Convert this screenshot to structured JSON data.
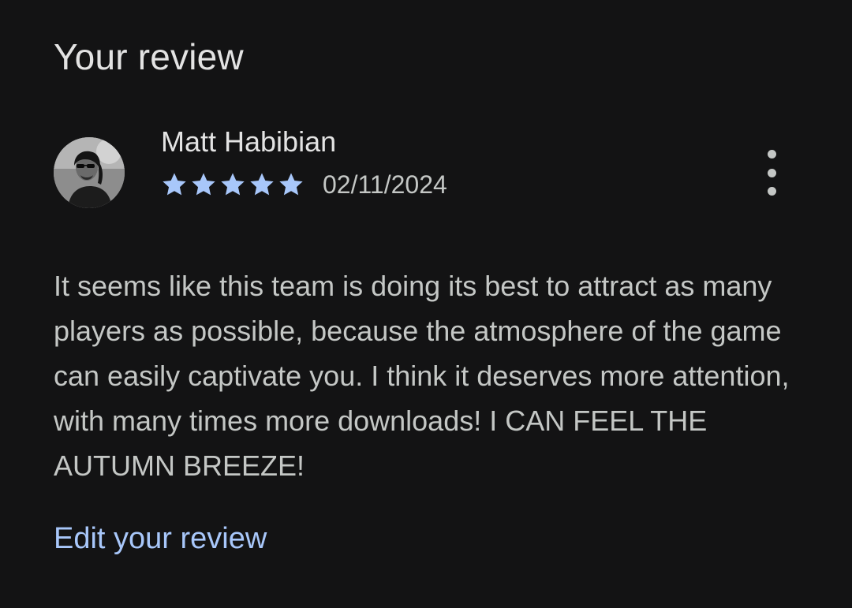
{
  "section": {
    "title": "Your review"
  },
  "review": {
    "author": "Matt Habibian",
    "rating": 5,
    "rating_max": 5,
    "date": "02/11/2024",
    "text": "It seems like this team is doing its best to attract as many players as possible, because the atmosphere of the game can easily captivate you. I think it deserves more attention, with many times more downloads! I CAN FEEL THE AUTUMN BREEZE!",
    "more_icon": "more-vert-icon",
    "avatar_icon": "avatar"
  },
  "actions": {
    "edit_label": "Edit your review"
  },
  "colors": {
    "background": "#131314",
    "primary_text": "#e3e3e3",
    "secondary_text": "#c4c7c5",
    "star": "#a8c7fa",
    "link": "#a8c7fa"
  }
}
